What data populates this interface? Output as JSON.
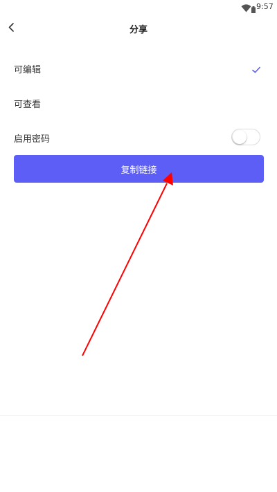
{
  "status_bar": {
    "time": "9:57",
    "icons": [
      "wifi-icon",
      "battery-icon"
    ]
  },
  "header": {
    "back_icon": "chevron-left-icon",
    "title": "分享"
  },
  "options": {
    "editable": {
      "label": "可编辑",
      "selected": true,
      "icon": "check-icon"
    },
    "viewable": {
      "label": "可查看",
      "selected": false
    },
    "password": {
      "label": "启用密码",
      "toggle_on": false
    }
  },
  "copy_button": {
    "label": "复制链接"
  },
  "colors": {
    "accent": "#5c5ef5",
    "check": "#5c5ef5",
    "annotation_arrow": "#ff0000"
  }
}
